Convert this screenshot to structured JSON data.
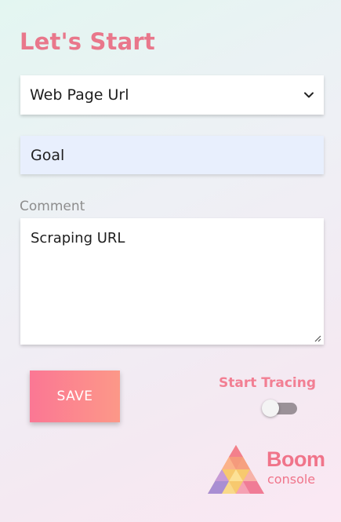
{
  "page": {
    "title": "Let's Start"
  },
  "source_select": {
    "value": "Web Page Url",
    "icon": "chevron-down-icon"
  },
  "goal_field": {
    "value": "Goal"
  },
  "comment": {
    "label": "Comment",
    "value": "Scraping URL"
  },
  "actions": {
    "save_label": "SAVE",
    "tracing_label": "Start Tracing",
    "tracing_enabled": false
  },
  "logo": {
    "brand": "Boom",
    "sub": "console"
  },
  "colors": {
    "accent": "#e9778b",
    "button_start": "#fb7794",
    "button_end": "#fc9888",
    "toggle_track": "#9b9198"
  }
}
